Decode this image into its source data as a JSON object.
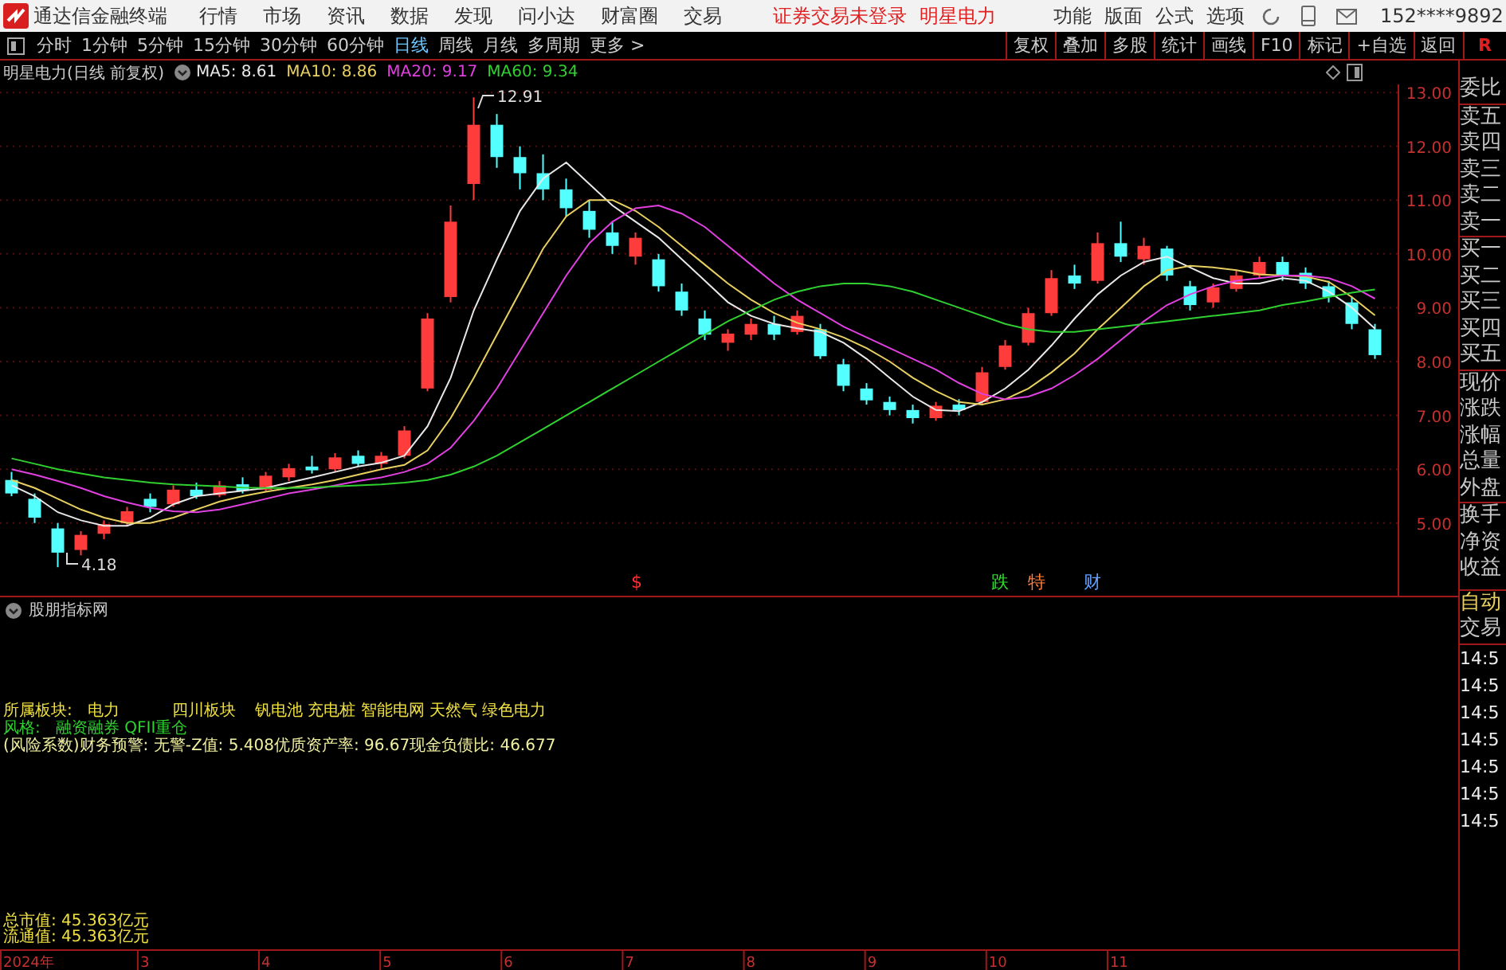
{
  "app": {
    "title": "通达信金融终端"
  },
  "menu": [
    "行情",
    "市场",
    "资讯",
    "数据",
    "发现",
    "问小达",
    "财富圈",
    "交易"
  ],
  "login_notice": "证券交易未登录",
  "stock_link": "明星电力",
  "menu_right": [
    "功能",
    "版面",
    "公式",
    "选项"
  ],
  "account": "152****9892",
  "periods": [
    {
      "label": "分时",
      "selected": false
    },
    {
      "label": "1分钟",
      "selected": false
    },
    {
      "label": "5分钟",
      "selected": false
    },
    {
      "label": "15分钟",
      "selected": false
    },
    {
      "label": "30分钟",
      "selected": false
    },
    {
      "label": "60分钟",
      "selected": false
    },
    {
      "label": "日线",
      "selected": true
    },
    {
      "label": "周线",
      "selected": false
    },
    {
      "label": "月线",
      "selected": false
    },
    {
      "label": "多周期",
      "selected": false
    }
  ],
  "more": "更多 >",
  "tools": [
    "复权",
    "叠加",
    "多股",
    "统计",
    "画线",
    "F10",
    "标记",
    "+自选",
    "返回"
  ],
  "tool_r": "R",
  "chart": {
    "title": "明星电力(日线 前复权)",
    "high_label": "12.91",
    "low_label": "4.18",
    "markers": [
      {
        "text": "$",
        "color": "#ff3030"
      },
      {
        "text": "跌",
        "color": "#30e030"
      },
      {
        "text": "特",
        "color": "#ff8040"
      },
      {
        "text": "财",
        "color": "#60a0ff"
      }
    ],
    "chart_data": {
      "type": "candlestick",
      "grid": true,
      "categories": [
        null,
        null,
        null,
        null,
        null,
        null,
        null,
        null,
        null,
        null,
        null,
        null,
        null,
        null,
        null,
        null,
        null,
        null,
        null,
        null,
        null,
        null,
        null,
        null,
        null,
        null,
        null,
        null,
        null,
        null,
        null,
        null,
        null,
        null,
        null,
        null,
        null,
        null,
        null,
        null,
        null,
        null,
        null,
        null,
        null,
        null,
        null,
        null,
        null,
        null,
        null,
        null,
        null,
        null,
        null,
        null,
        null,
        null,
        null,
        null
      ],
      "ohlc": [
        [
          5.8,
          5.95,
          5.5,
          5.55
        ],
        [
          5.45,
          5.55,
          5.0,
          5.1
        ],
        [
          4.9,
          5.0,
          4.18,
          4.45
        ],
        [
          4.5,
          4.85,
          4.4,
          4.78
        ],
        [
          4.8,
          5.05,
          4.7,
          4.98
        ],
        [
          5.0,
          5.3,
          4.95,
          5.22
        ],
        [
          5.45,
          5.55,
          5.2,
          5.3
        ],
        [
          5.35,
          5.7,
          5.3,
          5.62
        ],
        [
          5.62,
          5.75,
          5.45,
          5.5
        ],
        [
          5.52,
          5.78,
          5.48,
          5.7
        ],
        [
          5.72,
          5.85,
          5.55,
          5.6
        ],
        [
          5.62,
          5.95,
          5.58,
          5.88
        ],
        [
          5.85,
          6.1,
          5.78,
          6.02
        ],
        [
          6.05,
          6.25,
          5.92,
          5.98
        ],
        [
          6.0,
          6.3,
          5.95,
          6.22
        ],
        [
          6.25,
          6.35,
          6.05,
          6.1
        ],
        [
          6.1,
          6.32,
          6.02,
          6.25
        ],
        [
          6.25,
          6.8,
          6.2,
          6.72
        ],
        [
          7.5,
          8.9,
          7.45,
          8.8
        ],
        [
          9.2,
          10.9,
          9.1,
          10.6
        ],
        [
          11.3,
          12.91,
          11.0,
          12.4
        ],
        [
          12.4,
          12.6,
          11.6,
          11.8
        ],
        [
          11.8,
          12.0,
          11.2,
          11.5
        ],
        [
          11.5,
          11.85,
          11.0,
          11.2
        ],
        [
          11.2,
          11.4,
          10.7,
          10.85
        ],
        [
          10.8,
          11.0,
          10.3,
          10.45
        ],
        [
          10.4,
          10.6,
          10.0,
          10.15
        ],
        [
          9.95,
          10.4,
          9.8,
          10.3
        ],
        [
          9.9,
          10.0,
          9.3,
          9.4
        ],
        [
          9.3,
          9.45,
          8.85,
          8.95
        ],
        [
          8.8,
          8.95,
          8.4,
          8.5
        ],
        [
          8.35,
          8.6,
          8.2,
          8.52
        ],
        [
          8.5,
          8.8,
          8.4,
          8.7
        ],
        [
          8.7,
          8.85,
          8.4,
          8.5
        ],
        [
          8.55,
          8.95,
          8.5,
          8.85
        ],
        [
          8.6,
          8.7,
          8.05,
          8.1
        ],
        [
          7.95,
          8.05,
          7.45,
          7.55
        ],
        [
          7.5,
          7.6,
          7.2,
          7.28
        ],
        [
          7.25,
          7.35,
          7.0,
          7.1
        ],
        [
          7.1,
          7.2,
          6.85,
          6.95
        ],
        [
          6.95,
          7.25,
          6.9,
          7.18
        ],
        [
          7.2,
          7.3,
          7.0,
          7.1
        ],
        [
          7.25,
          7.9,
          7.2,
          7.8
        ],
        [
          7.9,
          8.4,
          7.85,
          8.3
        ],
        [
          8.35,
          9.0,
          8.3,
          8.9
        ],
        [
          8.9,
          9.7,
          8.85,
          9.55
        ],
        [
          9.6,
          9.8,
          9.35,
          9.45
        ],
        [
          9.5,
          10.4,
          9.45,
          10.2
        ],
        [
          10.2,
          10.6,
          9.85,
          9.95
        ],
        [
          9.9,
          10.3,
          9.8,
          10.15
        ],
        [
          10.1,
          10.15,
          9.5,
          9.6
        ],
        [
          9.4,
          9.5,
          8.95,
          9.05
        ],
        [
          9.1,
          9.45,
          9.0,
          9.38
        ],
        [
          9.35,
          9.7,
          9.3,
          9.6
        ],
        [
          9.6,
          9.95,
          9.55,
          9.85
        ],
        [
          9.85,
          9.95,
          9.5,
          9.6
        ],
        [
          9.65,
          9.75,
          9.35,
          9.45
        ],
        [
          9.4,
          9.5,
          9.1,
          9.2
        ],
        [
          9.1,
          9.2,
          8.6,
          8.7
        ],
        [
          8.6,
          8.7,
          8.05,
          8.12
        ]
      ],
      "series": [
        {
          "name": "MA5: 8.61",
          "type": "line",
          "color": "#e8e8e8",
          "values": [
            5.7,
            5.5,
            5.2,
            5.05,
            4.95,
            4.95,
            5.1,
            5.35,
            5.5,
            5.55,
            5.6,
            5.65,
            5.75,
            5.85,
            5.95,
            6.05,
            6.12,
            6.25,
            6.8,
            7.7,
            8.95,
            9.9,
            10.8,
            11.4,
            11.7,
            11.3,
            10.9,
            10.6,
            10.3,
            9.9,
            9.5,
            9.1,
            8.85,
            8.7,
            8.62,
            8.55,
            8.35,
            8.05,
            7.7,
            7.35,
            7.1,
            7.08,
            7.25,
            7.5,
            7.85,
            8.3,
            8.8,
            9.25,
            9.6,
            9.85,
            9.95,
            9.75,
            9.55,
            9.45,
            9.45,
            9.55,
            9.5,
            9.3,
            9.0,
            8.61
          ]
        },
        {
          "name": "MA10: 8.86",
          "type": "line",
          "color": "#e8d060",
          "values": [
            5.8,
            5.65,
            5.45,
            5.25,
            5.1,
            5.0,
            5.0,
            5.1,
            5.25,
            5.4,
            5.5,
            5.58,
            5.65,
            5.72,
            5.8,
            5.9,
            6.0,
            6.08,
            6.35,
            6.95,
            7.7,
            8.5,
            9.3,
            10.1,
            10.7,
            11.0,
            11.0,
            10.8,
            10.5,
            10.15,
            9.8,
            9.45,
            9.15,
            8.9,
            8.72,
            8.6,
            8.45,
            8.25,
            8.0,
            7.7,
            7.45,
            7.25,
            7.2,
            7.3,
            7.5,
            7.8,
            8.15,
            8.6,
            9.0,
            9.4,
            9.7,
            9.78,
            9.75,
            9.7,
            9.62,
            9.6,
            9.58,
            9.48,
            9.2,
            8.86
          ]
        },
        {
          "name": "MA20: 9.17",
          "type": "line",
          "color": "#e040e0",
          "values": [
            6.0,
            5.9,
            5.78,
            5.65,
            5.5,
            5.38,
            5.28,
            5.22,
            5.2,
            5.25,
            5.35,
            5.45,
            5.55,
            5.62,
            5.7,
            5.78,
            5.85,
            5.95,
            6.1,
            6.4,
            6.9,
            7.5,
            8.2,
            8.9,
            9.6,
            10.2,
            10.6,
            10.85,
            10.9,
            10.75,
            10.5,
            10.15,
            9.8,
            9.45,
            9.15,
            8.9,
            8.65,
            8.45,
            8.25,
            8.05,
            7.85,
            7.6,
            7.4,
            7.3,
            7.35,
            7.5,
            7.75,
            8.05,
            8.4,
            8.75,
            9.05,
            9.25,
            9.4,
            9.5,
            9.55,
            9.6,
            9.6,
            9.55,
            9.4,
            9.17
          ]
        },
        {
          "name": "MA60: 9.34",
          "type": "line",
          "color": "#30d030",
          "values": [
            6.2,
            6.1,
            6.0,
            5.92,
            5.85,
            5.8,
            5.75,
            5.72,
            5.7,
            5.68,
            5.66,
            5.65,
            5.65,
            5.66,
            5.68,
            5.7,
            5.72,
            5.75,
            5.8,
            5.9,
            6.05,
            6.25,
            6.5,
            6.75,
            7.0,
            7.25,
            7.5,
            7.75,
            8.0,
            8.25,
            8.5,
            8.75,
            8.95,
            9.15,
            9.3,
            9.4,
            9.45,
            9.45,
            9.4,
            9.3,
            9.15,
            9.0,
            8.85,
            8.7,
            8.6,
            8.55,
            8.55,
            8.6,
            8.65,
            8.7,
            8.75,
            8.8,
            8.85,
            8.9,
            8.95,
            9.05,
            9.12,
            9.2,
            9.28,
            9.34
          ]
        }
      ],
      "ylim": [
        3.65,
        13.15
      ],
      "yticks": [
        {
          "value": 13,
          "label": "13.00"
        },
        {
          "value": 12,
          "label": "12.00"
        },
        {
          "value": 11,
          "label": "11.00"
        },
        {
          "value": 10,
          "label": "10.00"
        },
        {
          "value": 9,
          "label": "9.00"
        },
        {
          "value": 8,
          "label": "8.00"
        },
        {
          "value": 7,
          "label": "7.00"
        },
        {
          "value": 6,
          "label": "6.00"
        },
        {
          "value": 5,
          "label": "5.00"
        }
      ]
    }
  },
  "dates": [
    "2024年",
    "3",
    "4",
    "5",
    "6",
    "7",
    "8",
    "9",
    "10",
    "11"
  ],
  "indicator": {
    "title": "股朋指标网",
    "sector_label": "所属板块:",
    "sector": "电力",
    "region": "四川板块",
    "concepts": "钒电池 充电桩 智能电网 天然气 绿色电力",
    "style_label": "风格:",
    "style": "融资融券 QFII重仓",
    "risk": "(风险系数)财务预警: 无警-Z值: 5.408优质资产率: 96.67现金负债比: 46.677",
    "total_cap": "总市值: 45.363亿元",
    "float_cap": "流通值: 45.363亿元"
  },
  "side_panel": {
    "quote_labels": [
      "委比",
      "卖五",
      "卖四",
      "卖三",
      "卖二",
      "卖一",
      "买一",
      "买二",
      "买三",
      "买四",
      "买五",
      "现价",
      "涨跌",
      "涨幅",
      "总量",
      "外盘",
      "换手",
      "净资",
      "收益"
    ],
    "auto": "自动",
    "trade": "交易",
    "times": [
      "14:5",
      "14:5",
      "14:5",
      "14:5",
      "14:5",
      "14:5",
      "14:5"
    ]
  }
}
